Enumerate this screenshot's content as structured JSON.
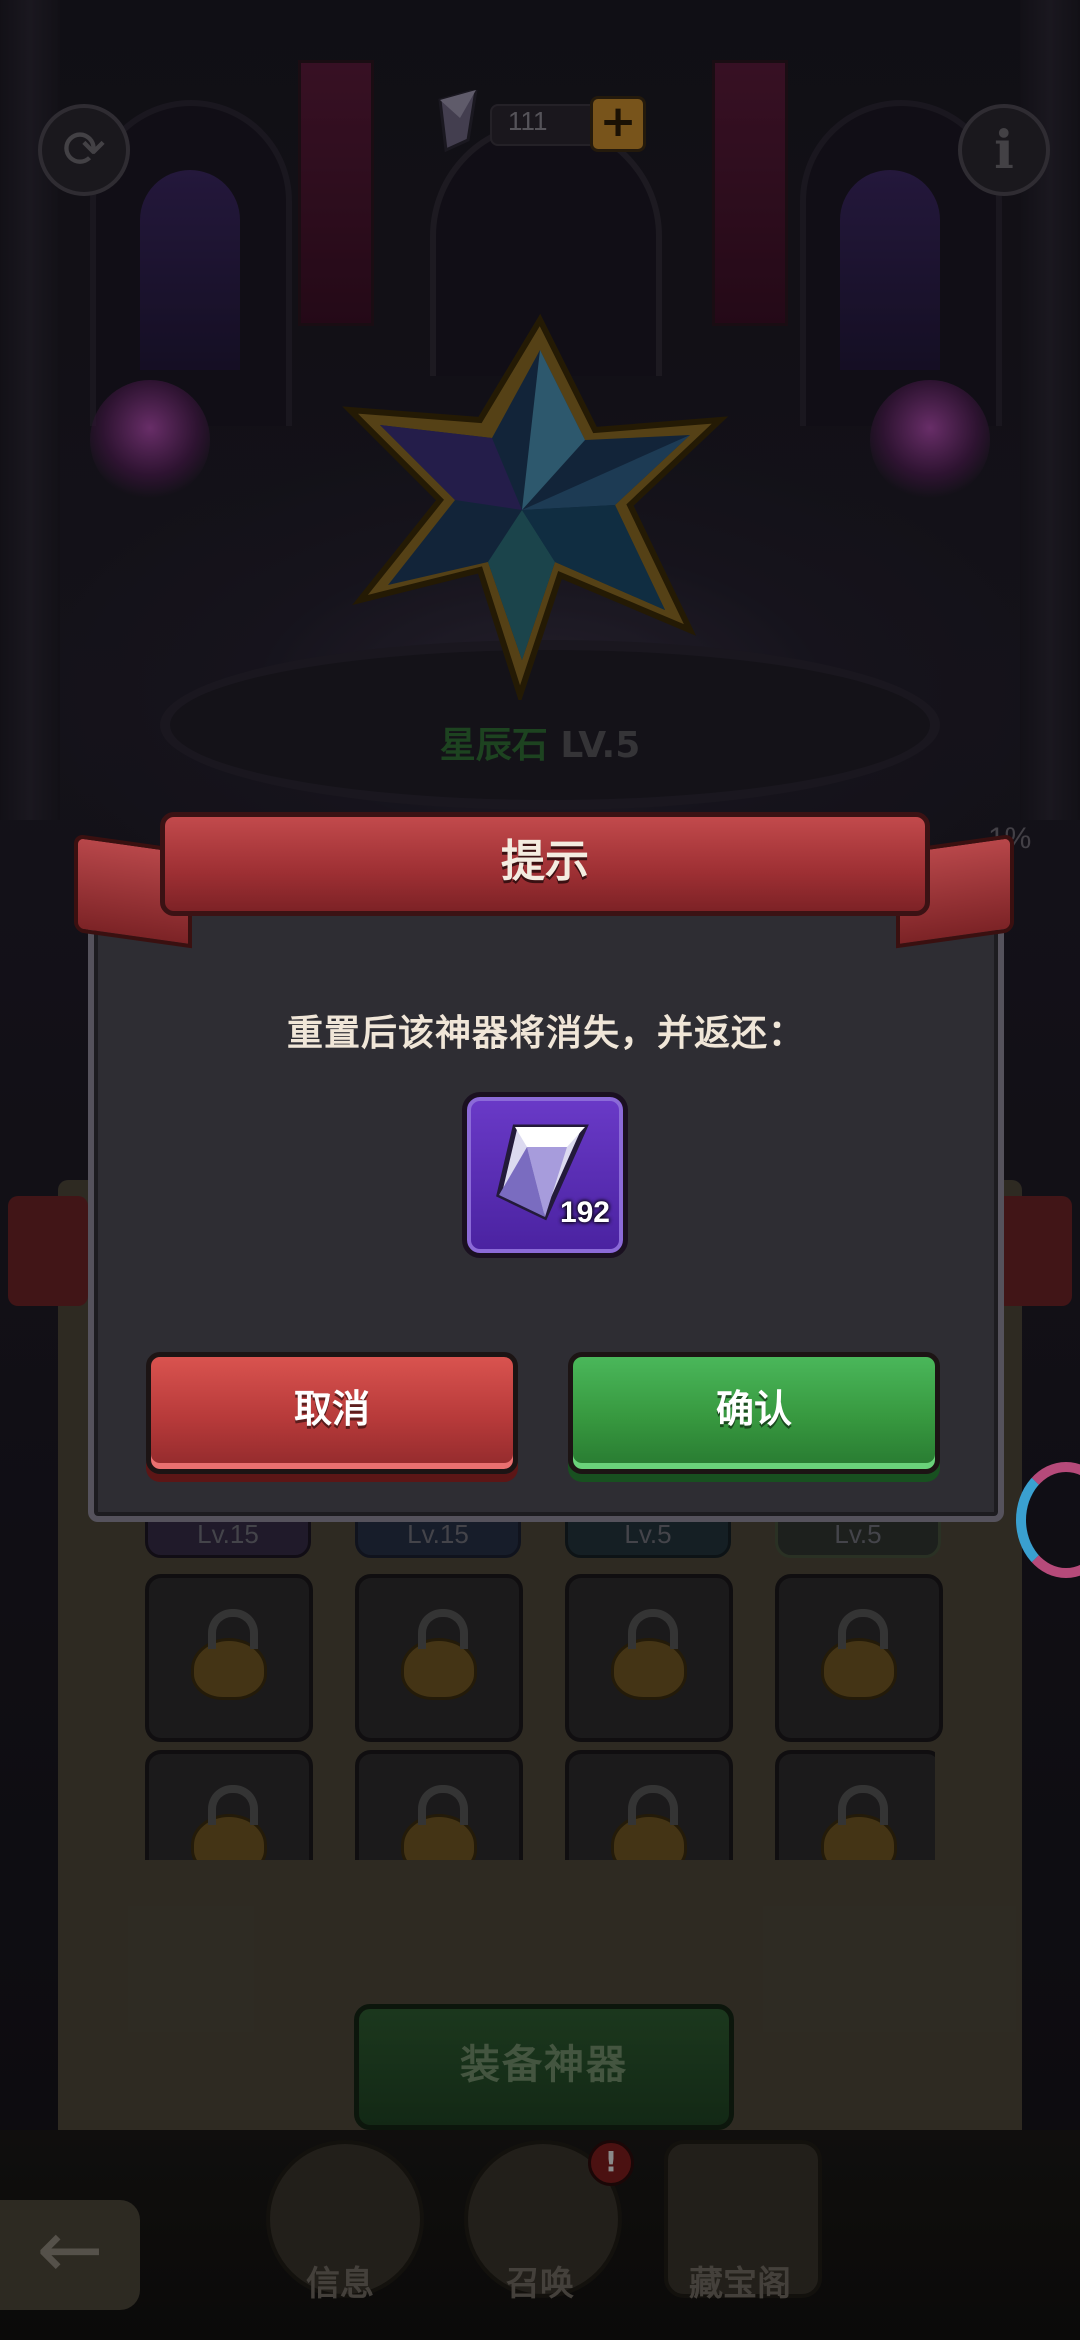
{
  "currency": {
    "amount": "111",
    "plus_label": "+"
  },
  "artifact": {
    "name": "星辰石",
    "level": "LV.5"
  },
  "progress_text": "1%",
  "grid": {
    "level_tags": [
      "Lv.15",
      "Lv.15",
      "Lv.5",
      "Lv.5"
    ]
  },
  "equip_button": "装备神器",
  "nav": {
    "back_label": "←",
    "items": [
      {
        "label": "信息"
      },
      {
        "label": "召唤",
        "badge": "!"
      },
      {
        "label": "藏宝阁"
      }
    ]
  },
  "dialog": {
    "title": "提示",
    "message": "重置后该神器将消失，并返还：",
    "reward": {
      "quantity": "192",
      "icon": "crystal-shard-icon"
    },
    "cancel_label": "取消",
    "confirm_label": "确认"
  },
  "colors": {
    "cancel": "#c0403f",
    "confirm": "#3fa349",
    "ribbon": "#a9383b",
    "dialog_bg": "#2e2d33",
    "reward_bg": "#5a2db5"
  }
}
